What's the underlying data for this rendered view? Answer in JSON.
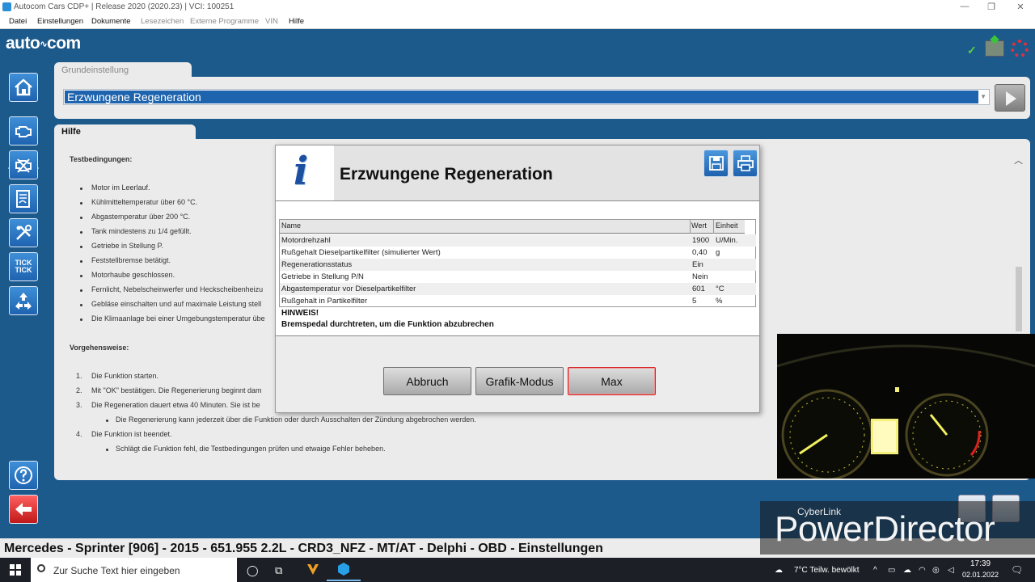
{
  "window": {
    "title": "Autocom Cars CDP+ | Release 2020 (2020.23) | VCI: 100251",
    "controls": [
      "—",
      "❐",
      "✕"
    ]
  },
  "menu": [
    "Datei",
    "Einstellungen",
    "Dokumente",
    "Lesezeichen",
    "Externe Programme",
    "VIN",
    "Hilfe"
  ],
  "header": {
    "logo": "auto com"
  },
  "sidebar": {
    "tick_label": "TICK TICK"
  },
  "basic_setting": {
    "tab_label": "Grundeinstellung",
    "selected_function": "Erzwungene Regeneration"
  },
  "help": {
    "tab_label": "Hilfe",
    "test_conditions_heading": "Testbedingungen:",
    "conditions": [
      "Motor im Leerlauf.",
      "Kühlmitteltemperatur über 60 °C.",
      "Abgastemperatur über 200 °C.",
      "Tank mindestens zu 1/4 gefüllt.",
      "Getriebe in Stellung P.",
      "Feststellbremse betätigt.",
      "Motorhaube geschlossen.",
      "Fernlicht, Nebelscheinwerfer und Heckscheibenheizu",
      "Gebläse einschalten und auf maximale Leistung stell",
      "Die Klimaanlage bei einer Umgebungstemperatur übe"
    ],
    "procedure_heading": "Vorgehensweise:",
    "steps": [
      {
        "num": "1.",
        "text": "Die Funktion starten."
      },
      {
        "num": "2.",
        "text": "Mit \"OK\" bestätigen. Die Regenerierung beginnt dam"
      },
      {
        "num": "3.",
        "text": "Die Regeneration dauert etwa 40 Minuten. Sie ist be"
      },
      {
        "num": "4.",
        "text": "Die Funktion ist beendet."
      }
    ],
    "step3_sub": "Die Regenerierung kann jederzeit über die Funktion oder durch Ausschalten der Zündung abgebrochen werden.",
    "step4_sub": "Schlägt die Funktion fehl, die Testbedingungen prüfen und etwaige Fehler beheben."
  },
  "dialog": {
    "title": "Erzwungene Regeneration",
    "icon": "info-icon",
    "table": {
      "headers": [
        "Name",
        "Wert",
        "Einheit"
      ],
      "rows": [
        {
          "name": "Motordrehzahl",
          "value": "1900",
          "unit": "U/Min."
        },
        {
          "name": "Rußgehalt Dieselpartikelfilter (simulierter Wert)",
          "value": "0,40",
          "unit": "g"
        },
        {
          "name": "Regenerationsstatus",
          "value": "Ein",
          "unit": ""
        },
        {
          "name": "Getriebe in Stellung P/N",
          "value": "Nein",
          "unit": ""
        },
        {
          "name": "Abgastemperatur vor Dieselpartikelfilter",
          "value": "601",
          "unit": "°C"
        },
        {
          "name": "Rußgehalt in Partikelfilter",
          "value": "5",
          "unit": "%"
        }
      ]
    },
    "hint_title": "HINWEIS!",
    "hint_text": "Bremspedal durchtreten, um die Funktion abzubrechen",
    "buttons": {
      "cancel": "Abbruch",
      "graph": "Grafik-Modus",
      "max": "Max"
    }
  },
  "status_bar": "Mercedes - Sprinter [906] - 2015 - 651.955 2.2L - CRD3_NFZ - MT/AT - Delphi - OBD - Einstellungen",
  "watermark": {
    "brand": "CyberLink",
    "product": "PowerDirector"
  },
  "taskbar": {
    "search_placeholder": "Zur Suche Text hier eingeben",
    "weather": "7°C  Teilw. bewölkt",
    "time": "17:39",
    "date": "02.01.2022"
  },
  "colors": {
    "brand_blue": "#1d5a8c",
    "selection": "#1e63ad",
    "focus_red": "#d42020"
  }
}
